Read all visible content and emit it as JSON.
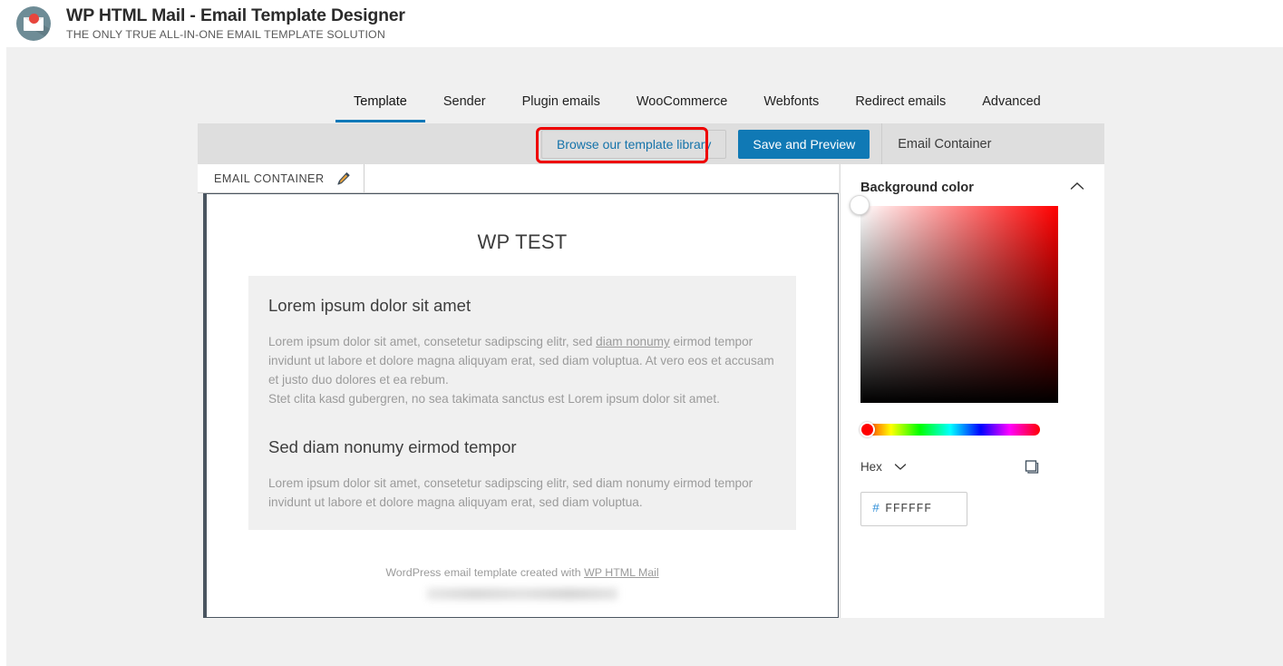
{
  "header": {
    "title": "WP HTML Mail - Email Template Designer",
    "subtitle": "THE ONLY TRUE ALL-IN-ONE EMAIL TEMPLATE SOLUTION",
    "logo_icon": "envelope-logo-icon"
  },
  "nav": {
    "tabs": [
      {
        "label": "Template",
        "active": true
      },
      {
        "label": "Sender",
        "active": false
      },
      {
        "label": "Plugin emails",
        "active": false
      },
      {
        "label": "WooCommerce",
        "active": false
      },
      {
        "label": "Webfonts",
        "active": false
      },
      {
        "label": "Redirect emails",
        "active": false
      },
      {
        "label": "Advanced",
        "active": false
      }
    ],
    "active_underline_color": "#0a78b8"
  },
  "toolbar": {
    "browse_library_label": "Browse our template library",
    "save_preview_label": "Save and Preview",
    "email_container_label": "Email Container",
    "save_button_color": "#1079b5",
    "highlight_color": "#ee0000",
    "annotation": {
      "shape": "red-arrow",
      "points_to": "Browse our template library"
    }
  },
  "container_tab": {
    "label": "EMAIL CONTAINER",
    "edit_icon": "pencil-icon"
  },
  "preview": {
    "title": "WP TEST",
    "heading_1": "Lorem ipsum dolor sit amet",
    "paragraph_1_before": "Lorem ipsum dolor sit amet, consetetur sadipscing elitr, sed ",
    "paragraph_1_link": "diam nonumy",
    "paragraph_1_after": " eirmod tempor invidunt ut labore et dolore magna aliquyam erat, sed diam voluptua. At vero eos et accusam et justo duo dolores et ea rebum.",
    "paragraph_1_line2": "Stet clita kasd gubergren, no sea takimata sanctus est Lorem ipsum dolor sit amet.",
    "heading_2": "Sed diam nonumy eirmod tempor",
    "paragraph_2": "Lorem ipsum dolor sit amet, consetetur sadipscing elitr, sed diam nonumy eirmod tempor invidunt ut labore et dolore magna aliquyam erat, sed diam voluptua.",
    "footer_text": "WordPress email template created with ",
    "footer_link": "WP HTML Mail",
    "block_background": "#f0f0f0"
  },
  "settings": {
    "panel_title": "Background color",
    "collapse_icon": "chevron-up-icon",
    "sv_picker": {
      "hue": "#ff0000",
      "handle_position": "top-left"
    },
    "hue_slider": {
      "handle_position": "left",
      "selected_hue": "#ff0000"
    },
    "format_label": "Hex",
    "format_caret_icon": "chevron-down-icon",
    "eyedropper_icon": "color-swatch-icon",
    "hex_prefix": "#",
    "hex_value": "FFFFFF",
    "hex_placeholder": "FFFFFF"
  }
}
